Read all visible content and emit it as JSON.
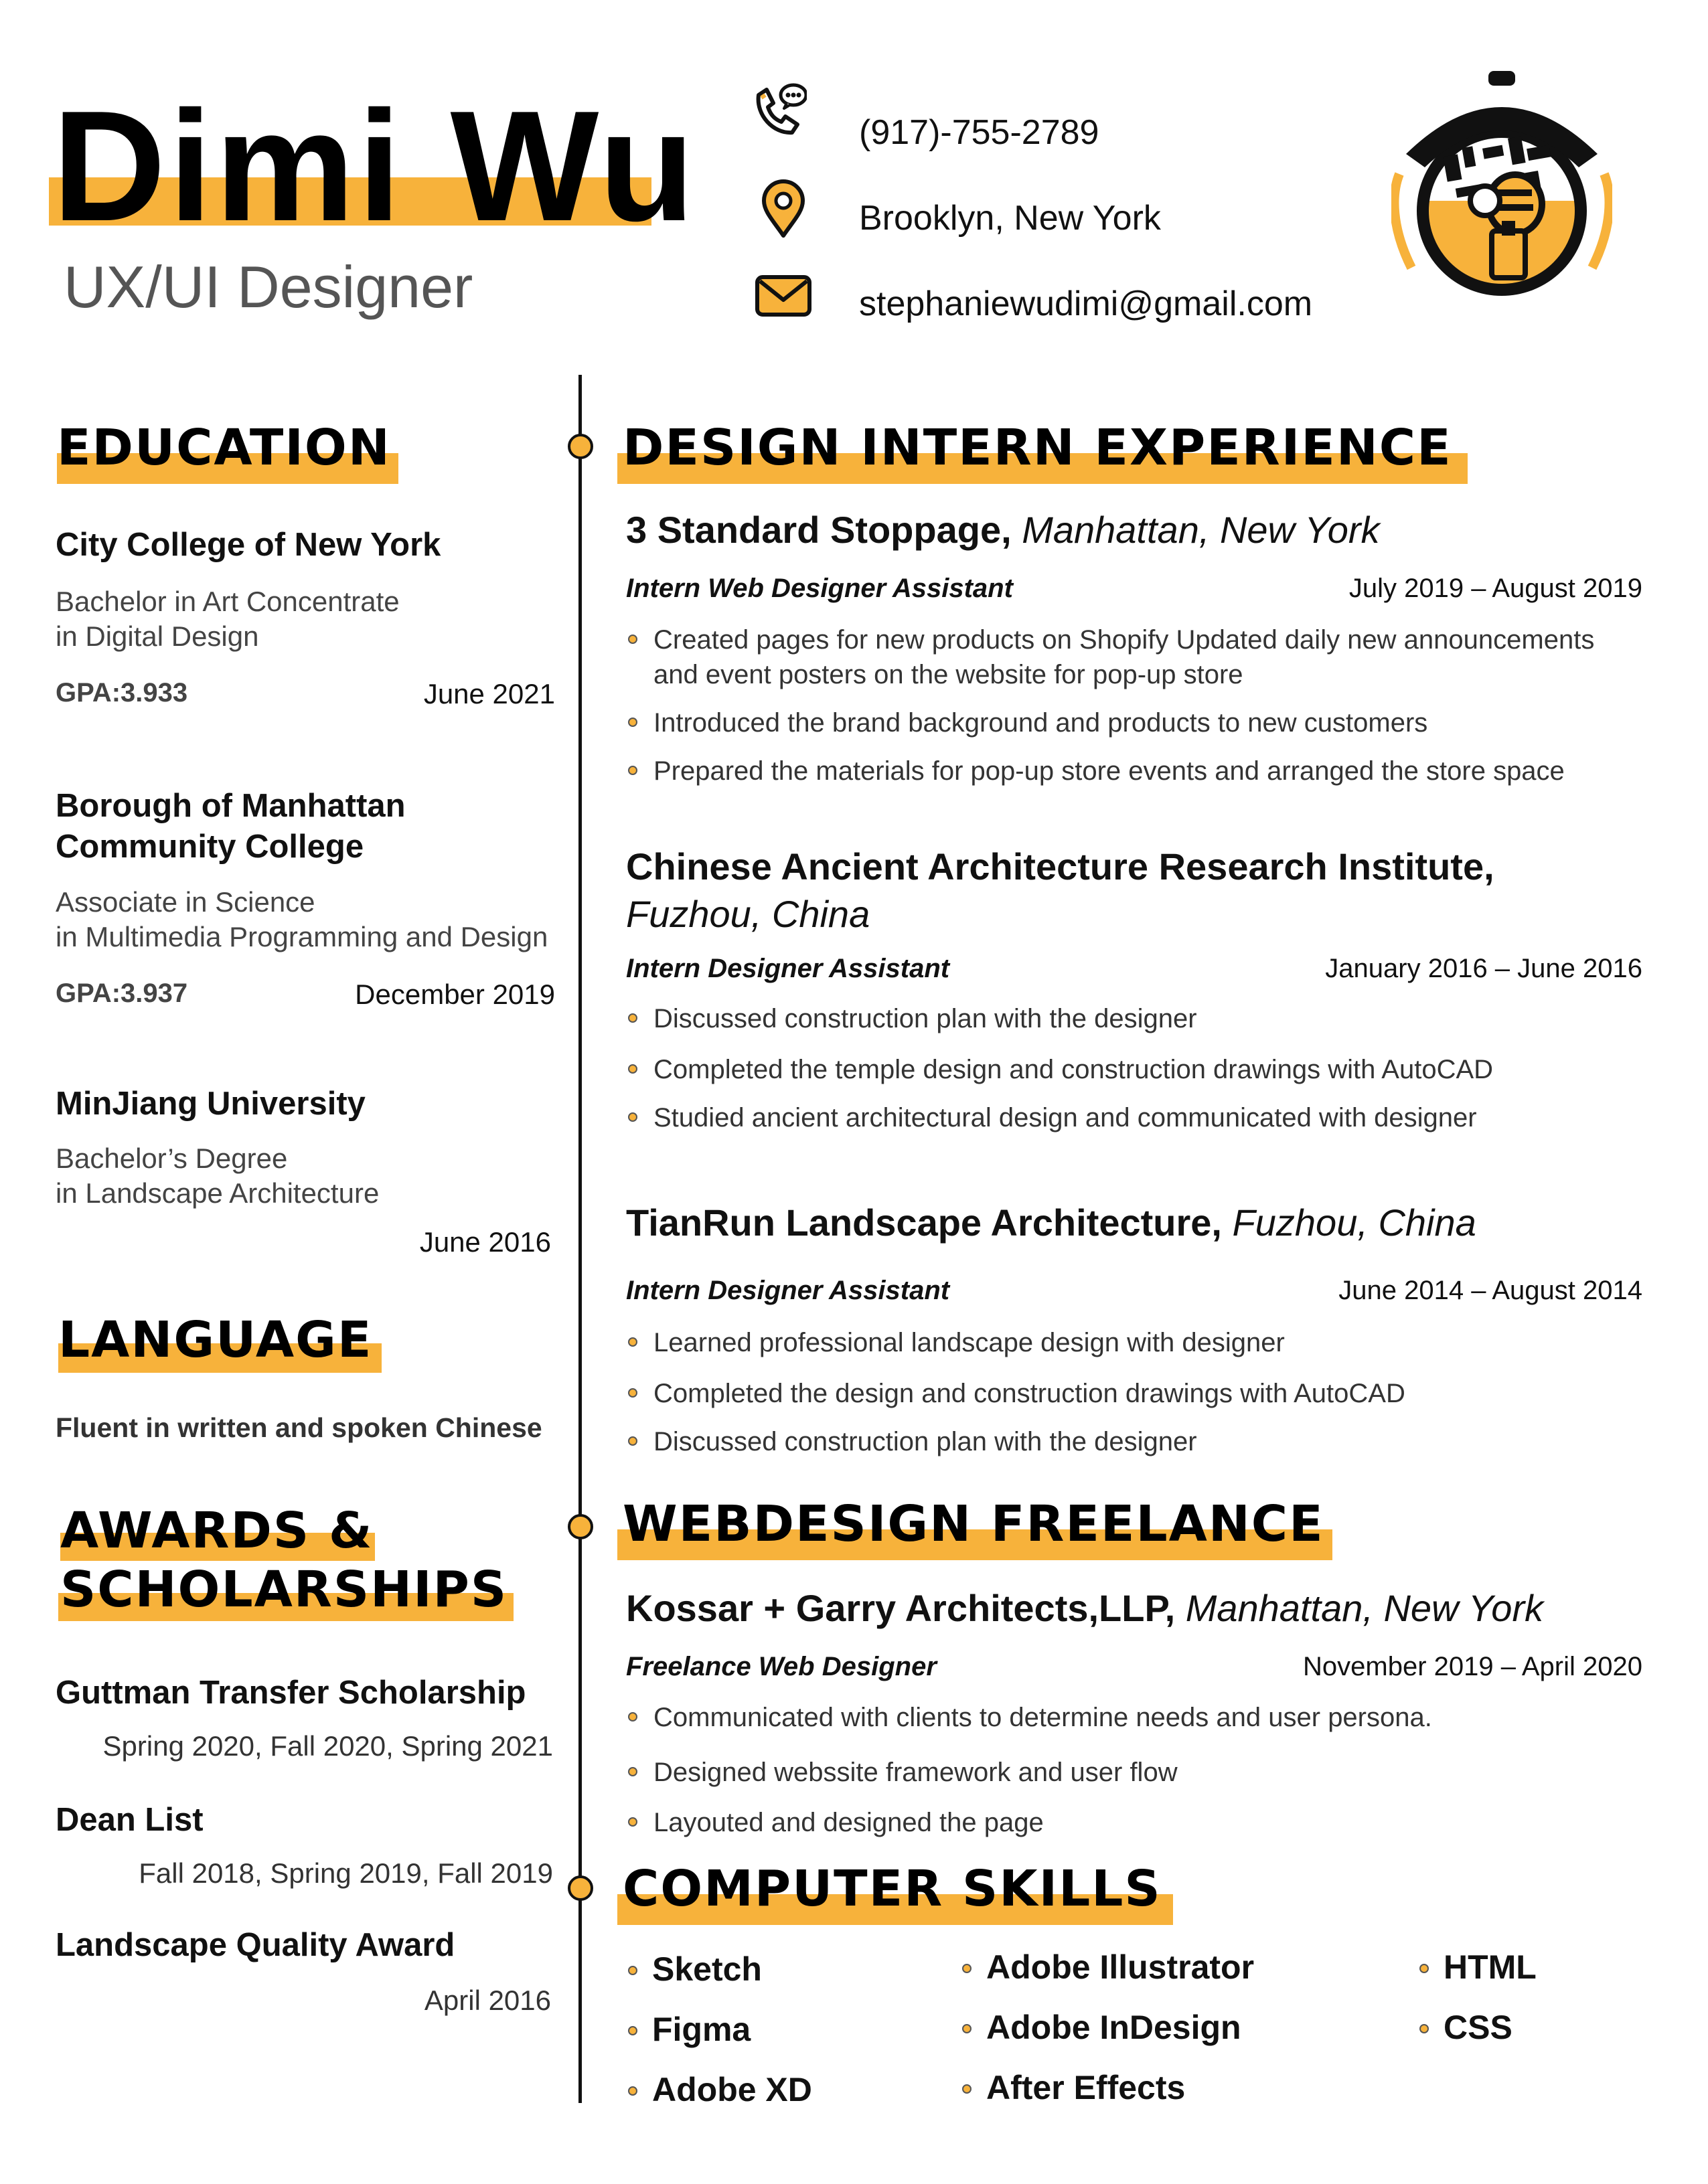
{
  "header": {
    "name": "Dimi Wu",
    "role": "UX/UI Designer",
    "phone": "(917)-755-2789",
    "location": "Brooklyn, New York",
    "email": "stephaniewudimi@gmail.com",
    "icons": [
      "phone-icon",
      "location-pin-icon",
      "mail-icon",
      "bee-logo"
    ]
  },
  "colors": {
    "accent": "#F7B23B",
    "text": "#111111",
    "muted": "#555555"
  },
  "education": {
    "heading": "EDUCATION",
    "items": [
      {
        "school": "City College of New York",
        "degree_line1": "Bachelor in Art Concentrate",
        "degree_line2": "in Digital Design",
        "gpa": "GPA:3.933",
        "date": "June 2021"
      },
      {
        "school_line1": "Borough of Manhattan",
        "school_line2": "Community College",
        "degree_line1": "Associate in Science",
        "degree_line2": "in Multimedia Programming and Design",
        "gpa": "GPA:3.937",
        "date": "December 2019"
      },
      {
        "school": "MinJiang University",
        "degree_line1": "Bachelor’s Degree",
        "degree_line2": "in Landscape Architecture",
        "date": "June 2016"
      }
    ]
  },
  "language": {
    "heading": "LANGUAGE",
    "text": "Fluent in written and spoken Chinese"
  },
  "awards": {
    "heading_line1": "AWARDS &",
    "heading_line2": "SCHOLARSHIPS",
    "items": [
      {
        "title": "Guttman Transfer Scholarship",
        "dates": "Spring 2020, Fall 2020, Spring 2021"
      },
      {
        "title": "Dean List",
        "dates": "Fall 2018, Spring 2019, Fall 2019"
      },
      {
        "title": "Landscape Quality Award",
        "dates": "April 2016"
      }
    ]
  },
  "experience": {
    "heading": "DESIGN INTERN EXPERIENCE",
    "jobs": [
      {
        "org": "3 Standard Stoppage,",
        "place": "Manhattan, New York",
        "role": "Intern Web Designer Assistant",
        "date": "July 2019 – August 2019",
        "bullets": [
          "Created pages for new products on Shopify Updated daily new announcements",
          "and event posters on the website for pop-up store",
          "Introduced the brand background and products to new customers",
          "Prepared the materials for pop-up store events and arranged the store space"
        ]
      },
      {
        "org": "Chinese Ancient Architecture Research Institute,",
        "place": "Fuzhou, China",
        "role": "Intern Designer Assistant",
        "date": "January 2016 – June 2016",
        "bullets": [
          "Discussed construction plan with the designer",
          "Completed the temple design and construction drawings with AutoCAD",
          "Studied ancient architectural design and communicated with designer"
        ]
      },
      {
        "org": "TianRun Landscape Architecture,",
        "place": "Fuzhou, China",
        "role": "Intern Designer Assistant",
        "date": "June 2014 – August 2014",
        "bullets": [
          "Learned professional landscape design with designer",
          "Completed the design and construction drawings with AutoCAD",
          "Discussed construction plan with the designer"
        ]
      }
    ]
  },
  "freelance": {
    "heading": "WEBDESIGN FREELANCE",
    "org": "Kossar + Garry Architects,LLP,",
    "place": "Manhattan, New York",
    "role": "Freelance Web Designer",
    "date": "November 2019 – April 2020",
    "bullets": [
      "Communicated with clients to determine needs and user persona.",
      "Designed webssite framework and user flow",
      "Layouted and designed the page"
    ]
  },
  "skills": {
    "heading": "COMPUTER SKILLS",
    "col1": [
      "Sketch",
      "Figma",
      "Adobe XD"
    ],
    "col2": [
      "Adobe Illustrator",
      "Adobe InDesign",
      "After Effects"
    ],
    "col3": [
      "HTML",
      "CSS"
    ]
  }
}
